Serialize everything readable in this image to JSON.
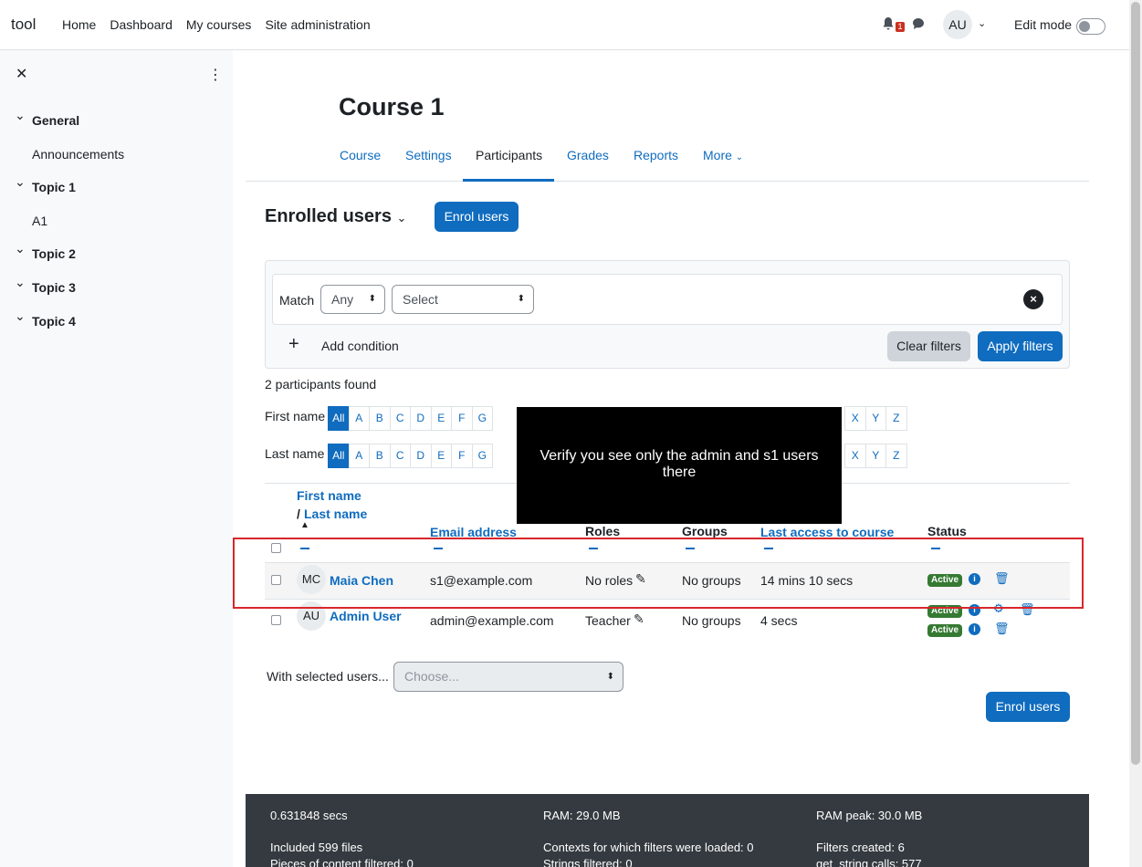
{
  "topnav": {
    "brand": "tool",
    "links": [
      "Home",
      "Dashboard",
      "My courses",
      "Site administration"
    ],
    "notification_count": "1",
    "user_initials": "AU",
    "edit_mode_label": "Edit mode"
  },
  "drawer": {
    "items": [
      {
        "label": "General",
        "type": "section"
      },
      {
        "label": "Announcements",
        "type": "sub"
      },
      {
        "label": "Topic 1",
        "type": "section"
      },
      {
        "label": "A1",
        "type": "sub"
      },
      {
        "label": "Topic 2",
        "type": "section"
      },
      {
        "label": "Topic 3",
        "type": "section"
      },
      {
        "label": "Topic 4",
        "type": "section"
      }
    ]
  },
  "course": {
    "title": "Course 1",
    "tabs": [
      "Course",
      "Settings",
      "Participants",
      "Grades",
      "Reports",
      "More"
    ],
    "active_tab": "Participants"
  },
  "participants": {
    "heading": "Enrolled users",
    "enrol_button": "Enrol users",
    "filter": {
      "match_label": "Match",
      "match_value": "Any",
      "select_value": "Select",
      "add_condition": "Add condition",
      "clear_filters": "Clear filters",
      "apply_filters": "Apply filters"
    },
    "found_text": "2 participants found",
    "first_name_label": "First name",
    "last_name_label": "Last name",
    "letters": [
      "All",
      "A",
      "B",
      "C",
      "D",
      "E",
      "F",
      "G",
      "X",
      "Y",
      "Z"
    ],
    "columns": {
      "first_name": "First name",
      "slash": "/",
      "last_name": "Last name",
      "email": "Email address",
      "roles": "Roles",
      "groups": "Groups",
      "last_access": "Last access to course",
      "status": "Status"
    },
    "rows": [
      {
        "initials": "MC",
        "name": "Maia Chen",
        "email": "s1@example.com",
        "roles": "No roles",
        "groups": "No groups",
        "last_access": "14 mins 10 secs",
        "status": [
          "Active"
        ]
      },
      {
        "initials": "AU",
        "name": "Admin User",
        "email": "admin@example.com",
        "roles": "Teacher",
        "groups": "No groups",
        "last_access": "4 secs",
        "status": [
          "Active",
          "Active"
        ]
      }
    ],
    "with_selected_label": "With selected users...",
    "with_selected_placeholder": "Choose...",
    "enrol_button_bottom": "Enrol users"
  },
  "overlay": {
    "text": "Verify you see only the admin and s1 users there"
  },
  "footer": {
    "time": "0.631848 secs",
    "ram": "RAM: 29.0 MB",
    "ram_peak": "RAM peak: 30.0 MB",
    "included": "Included 599 files",
    "contexts": "Contexts for which filters were loaded: 0",
    "filters_created": "Filters created: 6",
    "pieces": "Pieces of content filtered: 0",
    "strings": "Strings filtered: 0",
    "string_calls": "get_string calls: 577"
  },
  "colors": {
    "primary": "#0f6cbf",
    "success": "#357a32",
    "highlight": "#d9262b",
    "footer_bg": "#343a40"
  }
}
